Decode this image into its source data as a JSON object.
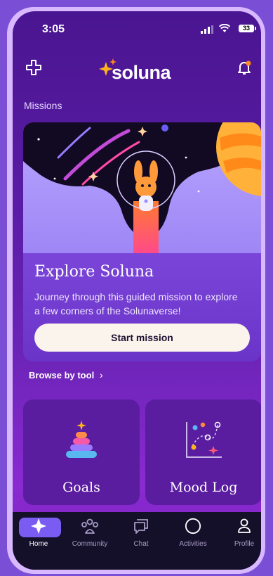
{
  "status": {
    "time": "3:05",
    "battery": "33"
  },
  "header": {
    "brand": "soluna"
  },
  "missions": {
    "section_title": "Missions",
    "card": {
      "title": "Explore Soluna",
      "description": "Journey through this guided mission to explore a few corners of the Solunaverse!",
      "button_label": "Start mission"
    }
  },
  "browse": {
    "label": "Browse by tool",
    "chevron": "›"
  },
  "tools": [
    {
      "label": "Goals",
      "icon": "stacked-rings-icon"
    },
    {
      "label": "Mood Log",
      "icon": "mood-graph-icon"
    }
  ],
  "nav": {
    "items": [
      {
        "label": "Home",
        "icon": "home-sparkle-icon",
        "active": true
      },
      {
        "label": "Community",
        "icon": "community-icon"
      },
      {
        "label": "Chat",
        "icon": "chat-icon"
      },
      {
        "label": "Activities",
        "icon": "activities-circle-icon"
      },
      {
        "label": "Profile",
        "icon": "profile-icon"
      }
    ]
  },
  "colors": {
    "accent": "#7a5cf2",
    "background": "#5a1ca6",
    "button": "#fbf4ec"
  }
}
